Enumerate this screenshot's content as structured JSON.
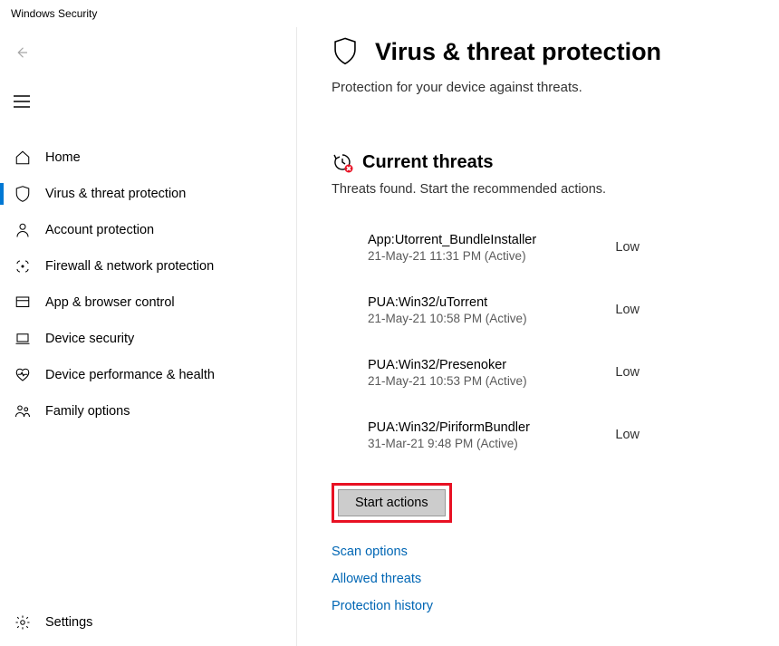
{
  "window": {
    "title": "Windows Security"
  },
  "sidebar": {
    "items": [
      {
        "label": "Home"
      },
      {
        "label": "Virus & threat protection"
      },
      {
        "label": "Account protection"
      },
      {
        "label": "Firewall & network protection"
      },
      {
        "label": "App & browser control"
      },
      {
        "label": "Device security"
      },
      {
        "label": "Device performance & health"
      },
      {
        "label": "Family options"
      }
    ],
    "settings": {
      "label": "Settings"
    }
  },
  "main": {
    "title": "Virus & threat protection",
    "subtitle": "Protection for your device against threats.",
    "currentThreats": {
      "heading": "Current threats",
      "description": "Threats found. Start the recommended actions.",
      "items": [
        {
          "name": "App:Utorrent_BundleInstaller",
          "meta": "21-May-21 11:31 PM (Active)",
          "severity": "Low"
        },
        {
          "name": "PUA:Win32/uTorrent",
          "meta": "21-May-21 10:58 PM (Active)",
          "severity": "Low"
        },
        {
          "name": "PUA:Win32/Presenoker",
          "meta": "21-May-21 10:53 PM (Active)",
          "severity": "Low"
        },
        {
          "name": "PUA:Win32/PiriformBundler",
          "meta": "31-Mar-21 9:48 PM (Active)",
          "severity": "Low"
        }
      ],
      "startActionsLabel": "Start actions",
      "links": [
        {
          "label": "Scan options"
        },
        {
          "label": "Allowed threats"
        },
        {
          "label": "Protection history"
        }
      ]
    }
  }
}
